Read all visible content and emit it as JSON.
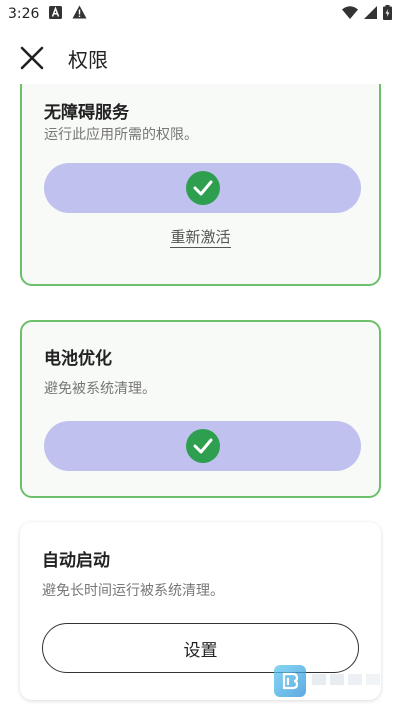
{
  "status_bar": {
    "time": "3:26"
  },
  "app_bar": {
    "title": "权限"
  },
  "cards": {
    "accessibility": {
      "title": "无障碍服务",
      "description": "运行此应用所需的权限。",
      "enabled": true,
      "link_label": "重新激活"
    },
    "battery": {
      "title": "电池优化",
      "description": "避免被系统清理。",
      "enabled": true
    },
    "autostart": {
      "title": "自动启动",
      "description": "避免长时间运行被系统清理。",
      "button_label": "设置"
    }
  },
  "colors": {
    "active_border": "#6cbf6b",
    "pill": "#c0c1ef",
    "check": "#2e9e4f"
  },
  "icons": [
    "close-icon",
    "check-icon",
    "wifi-icon",
    "signal-icon",
    "battery-icon"
  ]
}
